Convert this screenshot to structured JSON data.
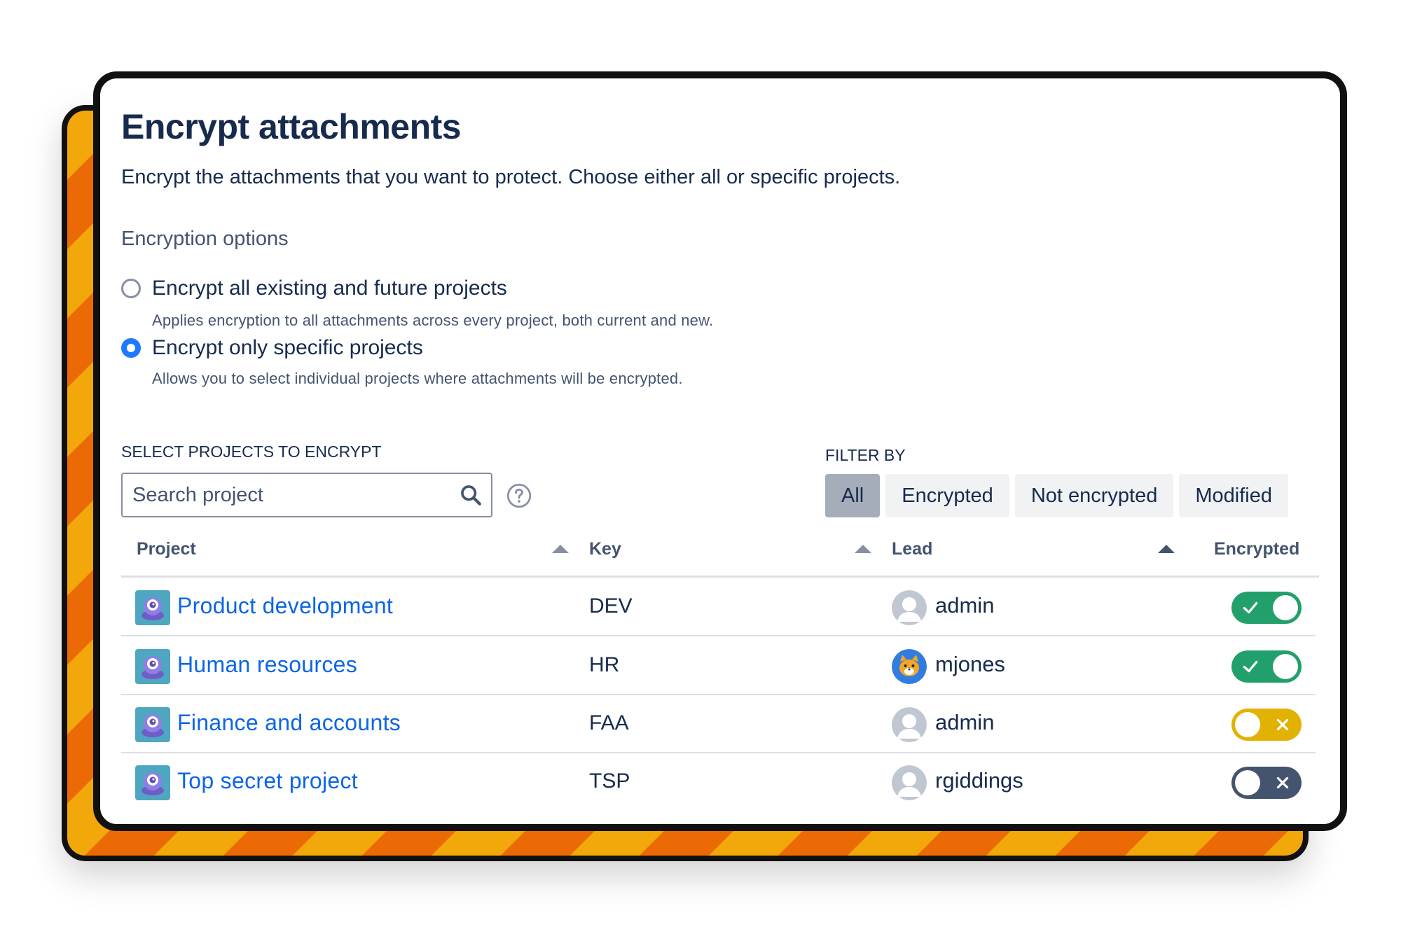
{
  "page": {
    "title": "Encrypt attachments",
    "description": "Encrypt the attachments that you want to protect. Choose either all or specific projects."
  },
  "encryption_options": {
    "heading": "Encryption options",
    "options": [
      {
        "label": "Encrypt all existing and future projects",
        "hint": "Applies encryption to all attachments across every project, both current and new.",
        "selected": false
      },
      {
        "label": "Encrypt only specific projects",
        "hint": "Allows you to select individual projects where attachments will be encrypted.",
        "selected": true
      }
    ]
  },
  "select_section": {
    "label": "SELECT PROJECTS TO ENCRYPT",
    "search": {
      "placeholder": "Search project",
      "value": "",
      "icon": "search-icon"
    },
    "help_icon": "question-circle-icon"
  },
  "filter": {
    "label": "FILTER BY",
    "options": [
      "All",
      "Encrypted",
      "Not encrypted",
      "Modified"
    ],
    "active": "All"
  },
  "table": {
    "columns": [
      "Project",
      "Key",
      "Lead",
      "Encrypted"
    ],
    "rows": [
      {
        "project": "Product development",
        "key": "DEV",
        "lead": "admin",
        "lead_avatar": "default-user-avatar",
        "encrypted": true,
        "toggle_state": "on"
      },
      {
        "project": "Human resources",
        "key": "HR",
        "lead": "mjones",
        "lead_avatar": "cat-avatar",
        "encrypted": true,
        "toggle_state": "on"
      },
      {
        "project": "Finance and accounts",
        "key": "FAA",
        "lead": "admin",
        "lead_avatar": "default-user-avatar",
        "encrypted": false,
        "toggle_state": "modified-off"
      },
      {
        "project": "Top secret project",
        "key": "TSP",
        "lead": "rgiddings",
        "lead_avatar": "default-user-avatar",
        "encrypted": false,
        "toggle_state": "off"
      }
    ]
  },
  "colors": {
    "title": "#172b4d",
    "link": "#0c66e4",
    "radio_selected": "#1d7afc",
    "toggle_on": "#22a06b",
    "toggle_modified": "#e2b203",
    "toggle_off": "#44546f",
    "filter_active": "#a6adba",
    "filter_inactive": "#f1f2f4",
    "back_card_stripe_a": "#f2a70a",
    "back_card_stripe_b": "#ec6a06"
  }
}
